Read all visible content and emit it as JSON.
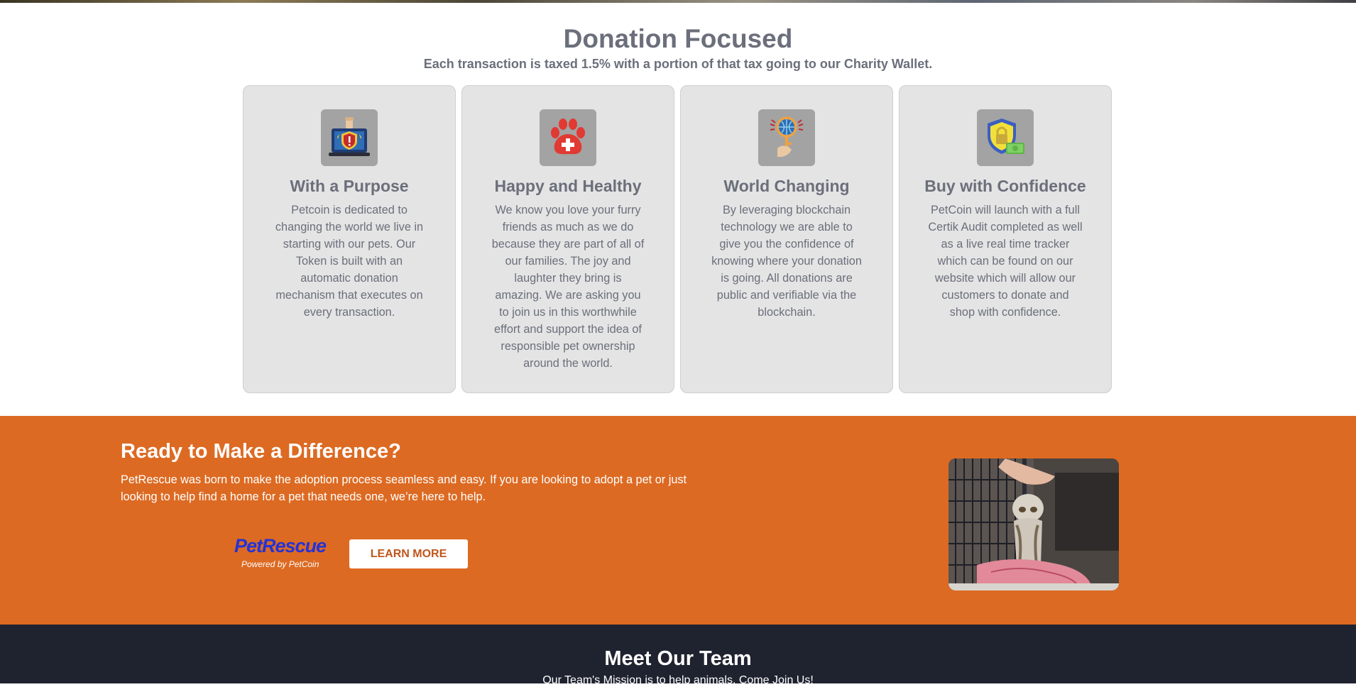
{
  "donation": {
    "title": "Donation Focused",
    "subtitle": "Each transaction is taxed 1.5% with a portion of that tax going to our Charity Wallet.",
    "cards": [
      {
        "icon": "laptop-shield-fist-icon",
        "title": "With a Purpose",
        "text": "Petcoin is dedicated to changing the world we live in starting with our pets. Our Token is built with an automatic donation mechanism that executes on every transaction."
      },
      {
        "icon": "paw-medical-cross-icon",
        "title": "Happy and Healthy",
        "text": "We know you love your furry friends as much as we do because they are part of all of our families. The joy and laughter they bring is amazing. We are asking you to join us in this worthwhile effort and support the idea of responsible pet ownership around the world."
      },
      {
        "icon": "hand-globe-key-icon",
        "title": "World Changing",
        "text": "By leveraging blockchain technology we are able to give you the confidence of knowing where your donation is going. All donations are public and verifiable via the blockchain."
      },
      {
        "icon": "shield-lock-money-icon",
        "title": "Buy with Confidence",
        "text": "PetCoin will launch with a full Certik Audit completed as well as a live real time tracker which can be found on our website which will allow our customers to donate and shop with confidence."
      }
    ]
  },
  "cta": {
    "title": "Ready to Make a Difference?",
    "text": "PetRescue was born to make the adoption process seamless and easy. If you are looking to adopt a pet or just looking to help find a home for a pet that needs one, we’re here to help.",
    "logo_word": "PetRescue",
    "logo_tag": "Powered by PetCoin",
    "button_label": "LEARN MORE",
    "photo": "cat-in-cage-photo",
    "bg_color": "#dd6a22"
  },
  "team": {
    "title": "Meet Our Team",
    "subtitle": "Our Team's Mission is to help animals. Come Join Us!",
    "bg_color": "#1f2330"
  }
}
